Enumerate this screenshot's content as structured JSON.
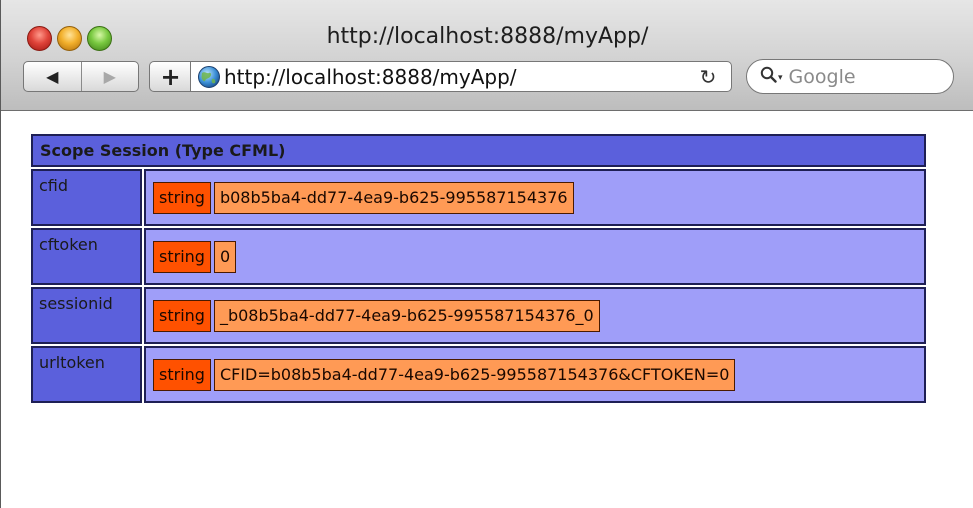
{
  "browser": {
    "window_title": "http://localhost:8888/myApp/",
    "url": "http://localhost:8888/myApp/",
    "search_placeholder": "Google",
    "nav": {
      "back_glyph": "◀",
      "forward_glyph": "▶",
      "add_glyph": "+",
      "reload_glyph": "↻"
    }
  },
  "dump": {
    "title": "Scope Session (Type CFML)",
    "rows": [
      {
        "key": "cfid",
        "type": "string",
        "value": "b08b5ba4-dd77-4ea9-b625-995587154376"
      },
      {
        "key": "cftoken",
        "type": "string",
        "value": "0"
      },
      {
        "key": "sessionid",
        "type": "string",
        "value": "_b08b5ba4-dd77-4ea9-b625-995587154376_0"
      },
      {
        "key": "urltoken",
        "type": "string",
        "value": "CFID=b08b5ba4-dd77-4ea9-b625-995587154376&CFTOKEN=0"
      }
    ]
  },
  "colors": {
    "scope_blue": "#5b60dc",
    "value_lavender": "#9f9ef9",
    "type_orange": "#ff5100",
    "value_orange": "#ff9a55"
  },
  "icons": [
    "close-button-icon",
    "minimize-button-icon",
    "zoom-button-icon",
    "back-arrow-icon",
    "forward-arrow-icon",
    "plus-icon",
    "globe-icon",
    "reload-icon",
    "search-icon"
  ]
}
